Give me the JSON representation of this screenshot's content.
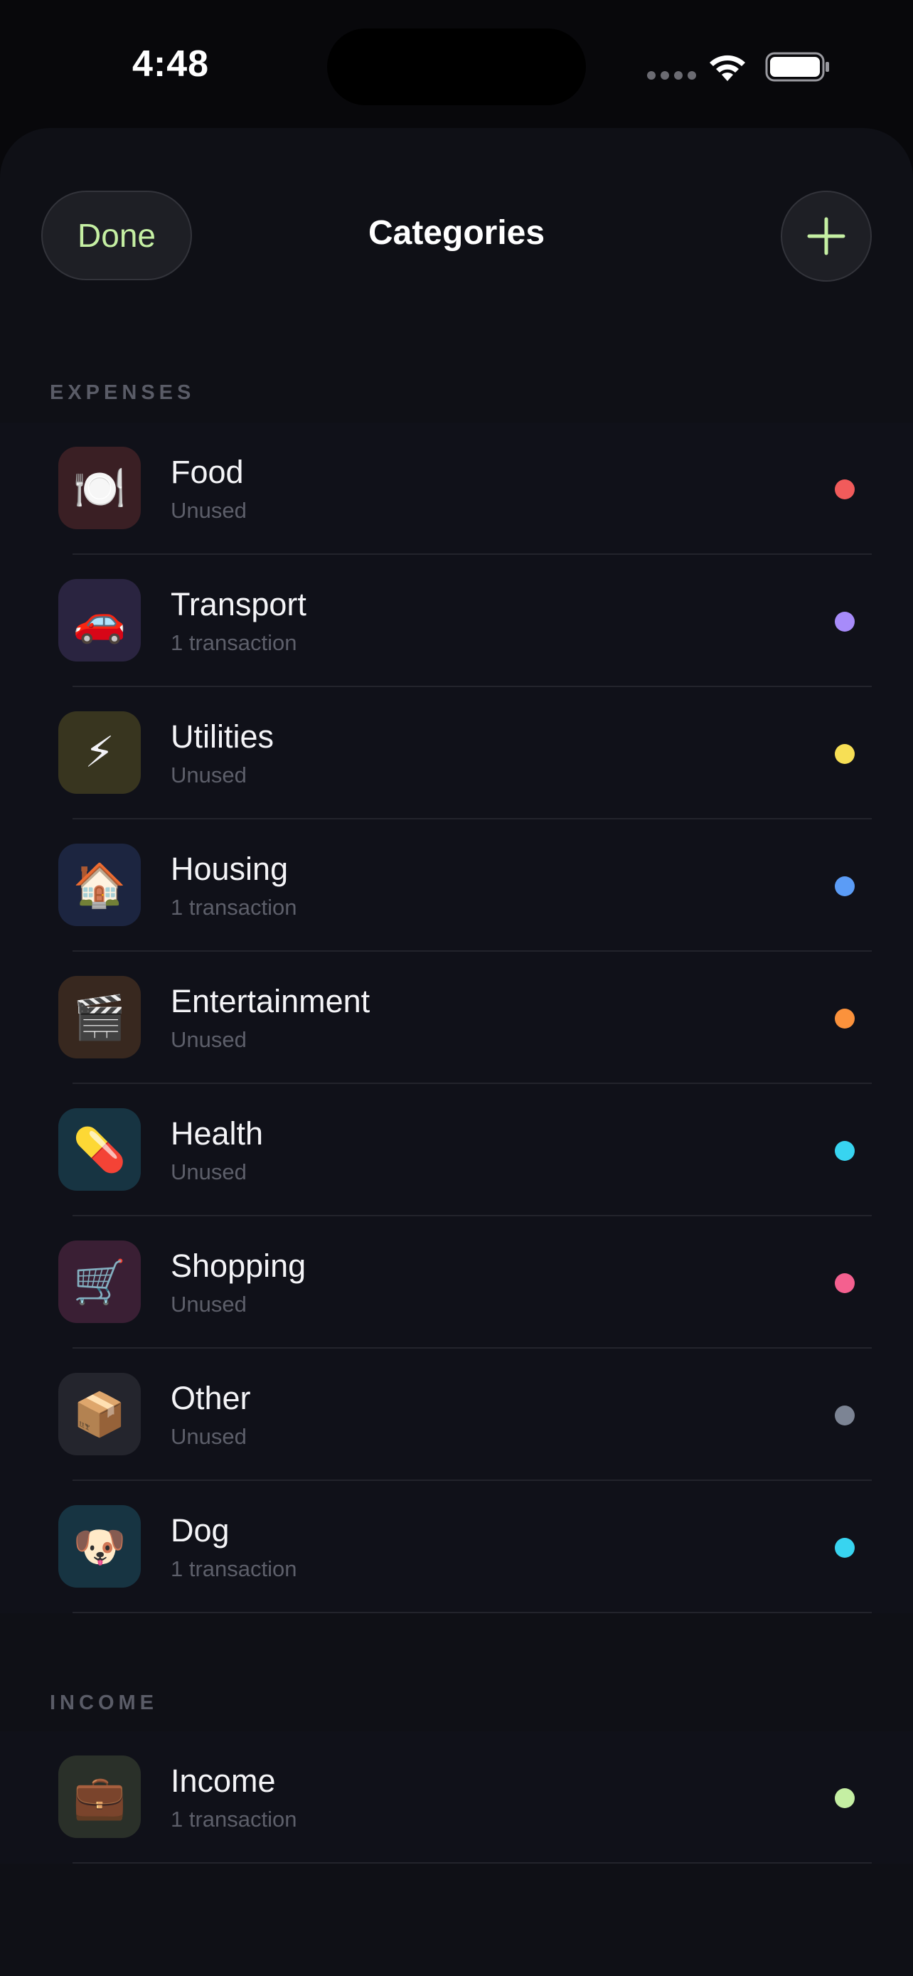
{
  "status_bar": {
    "time": "4:48"
  },
  "nav": {
    "done_label": "Done",
    "title": "Categories"
  },
  "expenses": {
    "header": "EXPENSES",
    "items": [
      {
        "name": "Food",
        "status": "Unused",
        "emoji": "🍽️",
        "icon": "plate-icon",
        "tile_color": "#3a1f24",
        "dot_color": "#f15b5b"
      },
      {
        "name": "Transport",
        "status": "1 transaction",
        "emoji": "🚗",
        "icon": "car-icon",
        "tile_color": "#2a2440",
        "dot_color": "#a78bfa"
      },
      {
        "name": "Utilities",
        "status": "Unused",
        "emoji": "⚡",
        "icon": "lightning-icon",
        "tile_color": "#38351f",
        "dot_color": "#f7df55"
      },
      {
        "name": "Housing",
        "status": "1 transaction",
        "emoji": "🏠",
        "icon": "house-icon",
        "tile_color": "#1c2540",
        "dot_color": "#5b9cf6"
      },
      {
        "name": "Entertainment",
        "status": "Unused",
        "emoji": "🎬",
        "icon": "clapperboard-icon",
        "tile_color": "#38281f",
        "dot_color": "#fb923c"
      },
      {
        "name": "Health",
        "status": "Unused",
        "emoji": "💊",
        "icon": "pill-icon",
        "tile_color": "#173442",
        "dot_color": "#38d4f0"
      },
      {
        "name": "Shopping",
        "status": "Unused",
        "emoji": "🛒",
        "icon": "cart-icon",
        "tile_color": "#3a1f34",
        "dot_color": "#f4608f"
      },
      {
        "name": "Other",
        "status": "Unused",
        "emoji": "📦",
        "icon": "package-icon",
        "tile_color": "#24252d",
        "dot_color": "#7c8494"
      },
      {
        "name": "Dog",
        "status": "1 transaction",
        "emoji": "🐶",
        "icon": "dog-icon",
        "tile_color": "#173442",
        "dot_color": "#38d4f0"
      }
    ]
  },
  "income": {
    "header": "INCOME",
    "items": [
      {
        "name": "Income",
        "status": "1 transaction",
        "emoji": "💼",
        "icon": "briefcase-icon",
        "tile_color": "#2a3029",
        "dot_color": "#c5efa3"
      }
    ]
  }
}
